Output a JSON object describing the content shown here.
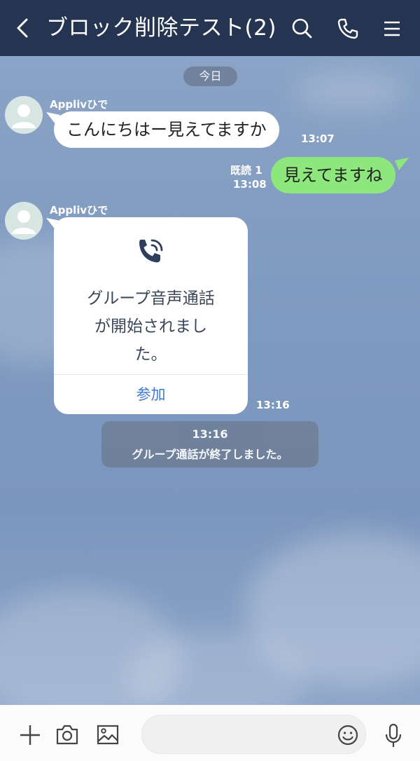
{
  "header": {
    "title": "ブロック削除テスト(2)",
    "bg_color": "#253450"
  },
  "date_label": "今日",
  "messages": [
    {
      "sender": "Applivひで",
      "text": "こんにちはー見えてますか",
      "time": "13:07"
    },
    {
      "text": "見えてますね",
      "read": "既読 1",
      "time": "13:08"
    },
    {
      "sender": "Applivひで",
      "call_text_lines": [
        "グループ音声通話",
        "が開始されまし",
        "た。"
      ],
      "join_label": "参加",
      "time": "13:16"
    }
  ],
  "end_notice": {
    "time": "13:16",
    "text": "グループ通話が終了しました。"
  },
  "input": {
    "placeholder": ""
  },
  "colors": {
    "own_bubble": "#8de77d",
    "join_link": "#3f7ad1"
  },
  "icons": [
    "back-icon",
    "search-icon",
    "phone-icon",
    "menu-icon",
    "plus-icon",
    "camera-icon",
    "image-icon",
    "emoji-icon",
    "mic-icon"
  ]
}
